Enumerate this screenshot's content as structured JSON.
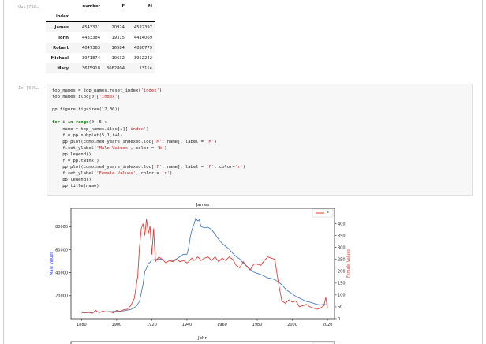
{
  "out_prompt": "Out[788…",
  "in_prompt": "In [699…",
  "table": {
    "columns": [
      "number",
      "F",
      "M"
    ],
    "index_name": "index",
    "rows": [
      {
        "name": "James",
        "number": "4543321",
        "F": "20924",
        "M": "4522397"
      },
      {
        "name": "John",
        "number": "4433384",
        "F": "19315",
        "M": "4414069"
      },
      {
        "name": "Robert",
        "number": "4047363",
        "F": "16584",
        "M": "4030779"
      },
      {
        "name": "Michael",
        "number": "3971874",
        "F": "19632",
        "M": "3952242"
      },
      {
        "name": "Mary",
        "number": "3675918",
        "F": "3662804",
        "M": "13114"
      }
    ]
  },
  "code_lines": [
    "top_names = top_names.reset_index('index')",
    "top_names.iloc[0]['index']",
    "",
    "pp.figure(figsize=(12,30))",
    "",
    "for i in range(0, 5):",
    "    name = top_names.iloc[i]['index']",
    "    f = pp.subplot(5,1,i+1)",
    "    pp.plot(combined_years_indexed.loc['M', name], label = 'M')",
    "    f.set_ylabel('Male Values', color = 'b')",
    "    pp.legend()",
    "    f = pp.twinx()",
    "    pp.plot(combined_years_indexed.loc['F', name], label = 'F', color='r')",
    "    f.set_ylabel('Female Values', color = 'r')",
    "    pp.legend()",
    "    pp.title(name)"
  ],
  "chart_data": [
    {
      "type": "line",
      "title": "James",
      "xlabel": "",
      "ylabel": "Male Values",
      "ylabel_right": "Female Values",
      "xlim": [
        1874,
        2024
      ],
      "ylim": [
        0,
        96000
      ],
      "ylim_right": [
        0,
        465
      ],
      "x_ticks": [
        1880,
        1900,
        1920,
        1940,
        1960,
        1980,
        2000,
        2020
      ],
      "y_ticks": [
        20000,
        40000,
        60000,
        80000
      ],
      "y_ticks_right": [
        0,
        50,
        100,
        150,
        200,
        250,
        300,
        350,
        400
      ],
      "legend": {
        "entries": [
          "F"
        ],
        "position": "top-right"
      },
      "grid": false,
      "series": [
        {
          "name": "M",
          "axis": "left",
          "color": "#4a7fc0",
          "x": [
            1880,
            1884,
            1888,
            1892,
            1896,
            1900,
            1904,
            1908,
            1911,
            1913,
            1915,
            1916,
            1917,
            1918,
            1919,
            1920,
            1922,
            1924,
            1926,
            1928,
            1930,
            1932,
            1934,
            1936,
            1938,
            1940,
            1941,
            1942,
            1943,
            1944,
            1945,
            1946,
            1947,
            1948,
            1950,
            1952,
            1954,
            1956,
            1958,
            1960,
            1962,
            1964,
            1966,
            1968,
            1970,
            1972,
            1974,
            1976,
            1978,
            1980,
            1982,
            1984,
            1986,
            1988,
            1990,
            1992,
            1994,
            1996,
            1998,
            2000,
            2002,
            2004,
            2006,
            2008,
            2010,
            2012,
            2014,
            2016,
            2018,
            2020
          ],
          "y": [
            5000,
            5300,
            5800,
            6000,
            6100,
            6400,
            6800,
            8000,
            10500,
            15000,
            30000,
            41000,
            44000,
            48000,
            49000,
            51000,
            51500,
            52000,
            51500,
            51000,
            51000,
            50500,
            52000,
            54000,
            56000,
            56000,
            62000,
            72000,
            78000,
            82000,
            87500,
            85000,
            86000,
            80000,
            79000,
            79500,
            77500,
            73500,
            69000,
            65500,
            63000,
            60500,
            57000,
            54000,
            52000,
            48500,
            46000,
            43000,
            40500,
            39500,
            38500,
            37000,
            35500,
            35000,
            34000,
            32000,
            29500,
            26000,
            23500,
            21500,
            19500,
            18000,
            16500,
            15000,
            14500,
            13500,
            12500,
            12000,
            12500,
            12000
          ]
        },
        {
          "name": "F",
          "axis": "right",
          "color": "#e0403a",
          "x": [
            1880,
            1882,
            1884,
            1886,
            1888,
            1890,
            1892,
            1894,
            1896,
            1898,
            1900,
            1902,
            1904,
            1906,
            1908,
            1910,
            1912,
            1913,
            1914,
            1915,
            1916,
            1917,
            1918,
            1919,
            1920,
            1921,
            1922,
            1924,
            1926,
            1928,
            1930,
            1932,
            1934,
            1936,
            1938,
            1940,
            1941,
            1942,
            1943,
            1944,
            1945,
            1946,
            1947,
            1948,
            1950,
            1952,
            1954,
            1956,
            1958,
            1960,
            1962,
            1964,
            1966,
            1968,
            1970,
            1972,
            1974,
            1976,
            1978,
            1980,
            1982,
            1984,
            1986,
            1988,
            1990,
            1992,
            1994,
            1996,
            1998,
            2000,
            2002,
            2004,
            2006,
            2008,
            2010,
            2012,
            2014,
            2016,
            2018,
            2019,
            2020
          ],
          "y": [
            30,
            25,
            28,
            22,
            35,
            25,
            32,
            28,
            30,
            24,
            35,
            30,
            38,
            40,
            55,
            85,
            180,
            300,
            380,
            400,
            350,
            420,
            360,
            390,
            270,
            380,
            240,
            260,
            250,
            235,
            245,
            240,
            250,
            240,
            245,
            235,
            240,
            250,
            255,
            245,
            250,
            260,
            255,
            245,
            255,
            260,
            245,
            260,
            240,
            255,
            245,
            260,
            250,
            225,
            215,
            240,
            220,
            205,
            230,
            230,
            225,
            245,
            260,
            255,
            250,
            155,
            75,
            65,
            80,
            70,
            75,
            50,
            55,
            60,
            50,
            45,
            40,
            45,
            55,
            90,
            45
          ]
        }
      ]
    },
    {
      "type": "line",
      "title": "John",
      "xlabel": "",
      "ylabel": "",
      "legend": {
        "entries": [],
        "position": "top-right"
      },
      "series": []
    }
  ]
}
